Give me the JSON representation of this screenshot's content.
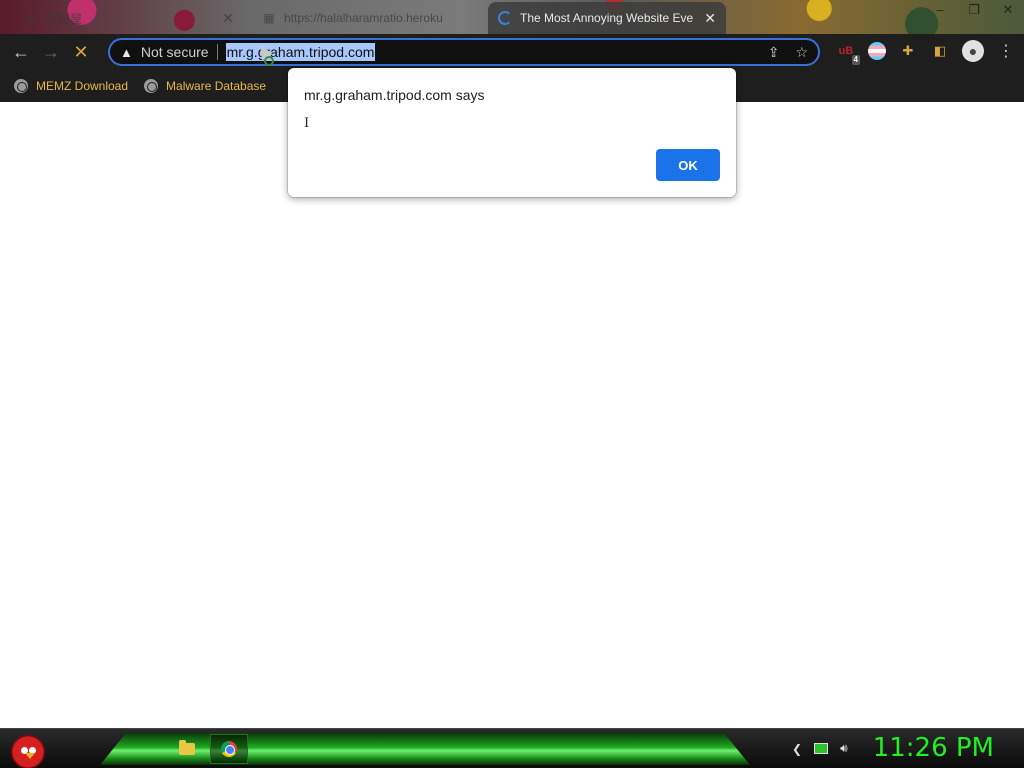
{
  "tabs": [
    {
      "title": "吉田屋",
      "icon": "globe-icon",
      "active": false
    },
    {
      "title": "https://halalharamratio.heroku",
      "icon": "calculator-icon",
      "active": false
    },
    {
      "title": "The Most Annoying Website Eve",
      "icon": "loading-spinner-icon",
      "active": true
    }
  ],
  "window_controls": {
    "minimize": "–",
    "restore": "❐",
    "close": "✕"
  },
  "omnibox": {
    "security_label": "Not secure",
    "url": "mr.g.graham.tripod.com"
  },
  "toolbar": {
    "back": "←",
    "forward": "→",
    "stop": "✕"
  },
  "extensions": {
    "ublock_badge": "4"
  },
  "bookmarks": [
    {
      "label": "MEMZ Download"
    },
    {
      "label": "Malware Database"
    }
  ],
  "dialog": {
    "title": "mr.g.graham.tripod.com says",
    "message": "I",
    "ok_label": "OK"
  },
  "taskbar": {
    "clock": "11:26 PM"
  },
  "colors": {
    "accent_blue": "#1a73e8",
    "bookmark_text": "#e8b84a",
    "clock_green": "#22ee22"
  }
}
